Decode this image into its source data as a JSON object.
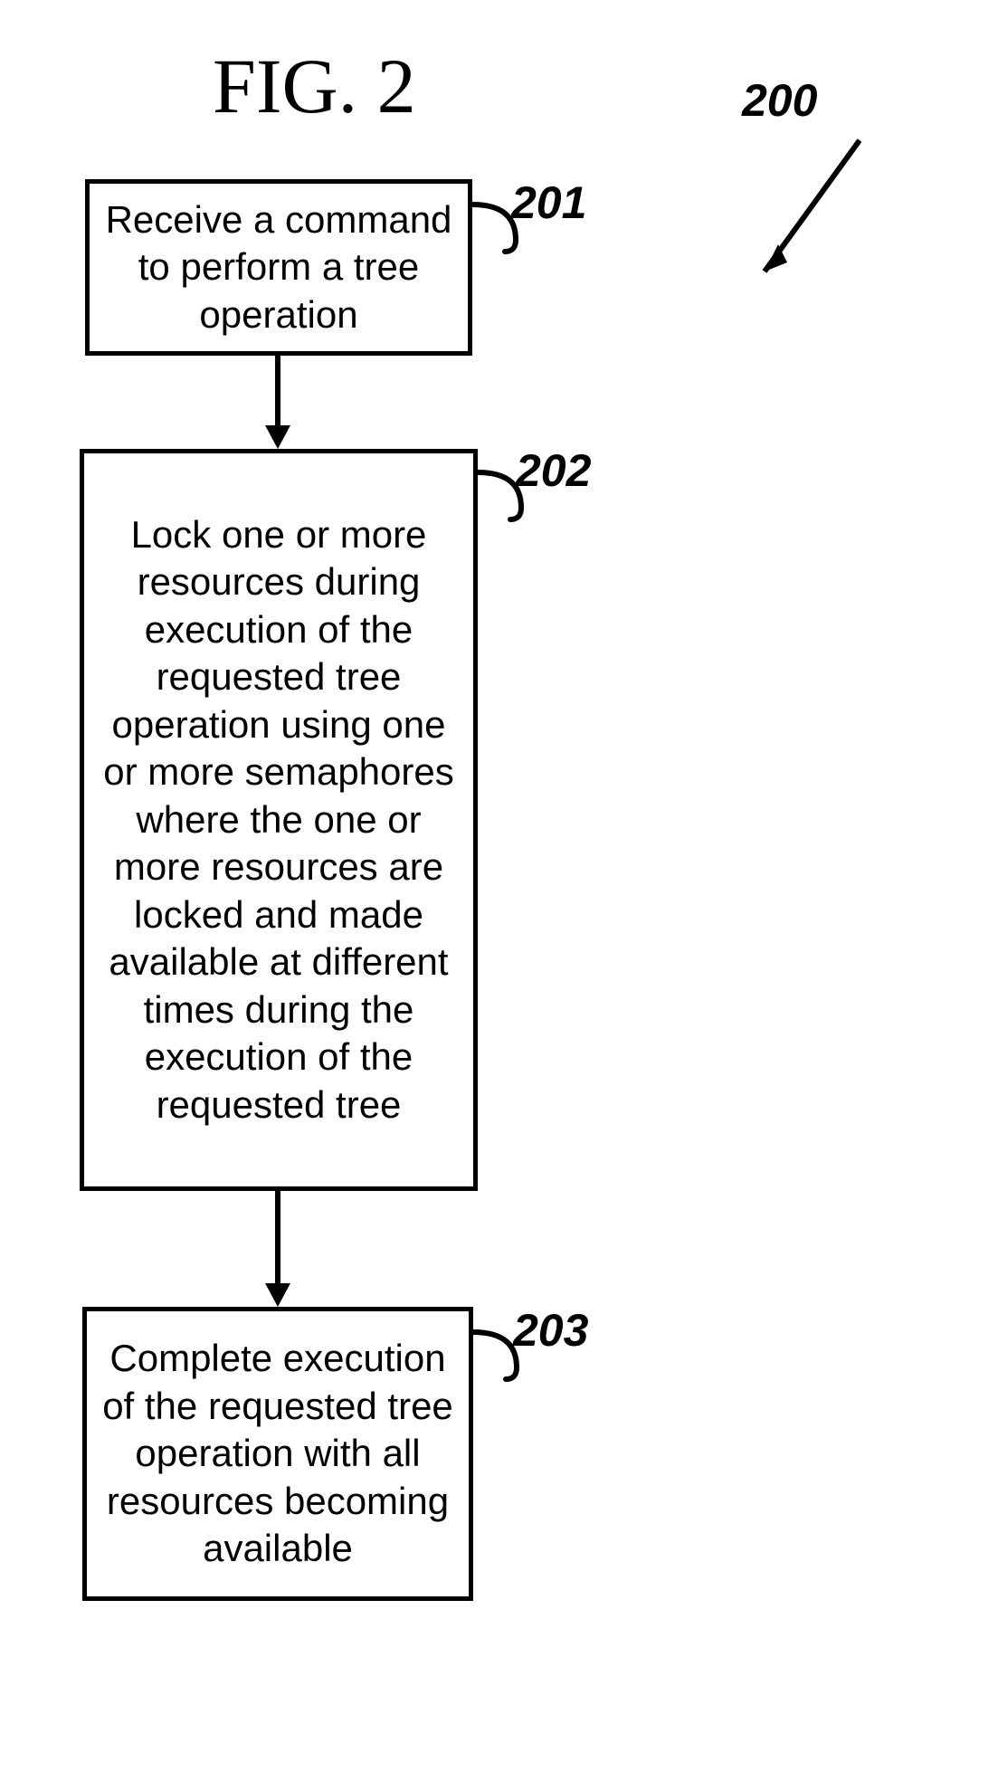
{
  "figure": {
    "title": "FIG. 2",
    "id": "200",
    "steps": [
      {
        "num": "201",
        "text": "Receive a command to perform a tree operation"
      },
      {
        "num": "202",
        "text": "Lock one or more resources during execution of the requested tree operation using one or more semaphores where the one or more resources are locked and made available at different times during the execution of the requested tree"
      },
      {
        "num": "203",
        "text": "Complete execution of the requested tree operation with all resources becoming available"
      }
    ]
  }
}
